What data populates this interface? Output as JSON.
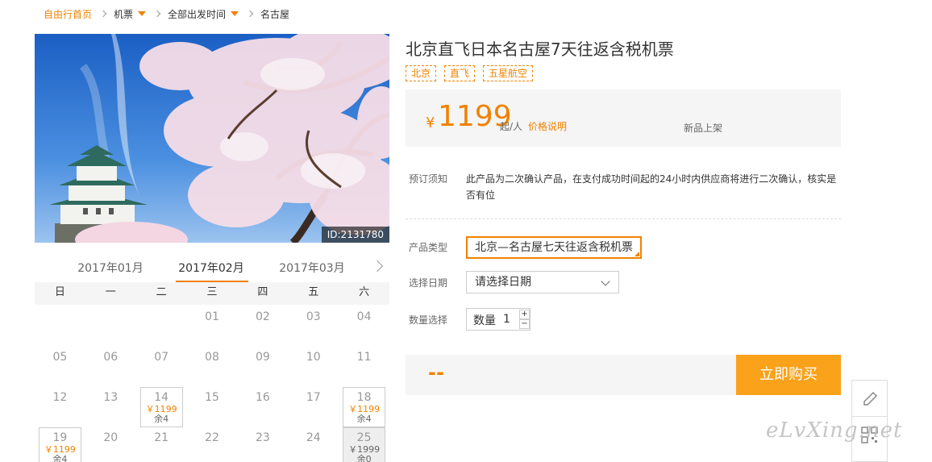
{
  "breadcrumb": {
    "home": "自由行首页",
    "flights": "机票",
    "departure": "全部出发时间",
    "current": "名古屋"
  },
  "hero": {
    "id_label": "ID:2131780"
  },
  "calendar": {
    "months": [
      "2017年01月",
      "2017年02月",
      "2017年03月"
    ],
    "weekdays": [
      "日",
      "一",
      "二",
      "三",
      "四",
      "五",
      "六"
    ],
    "rows": [
      [
        {
          "d": ""
        },
        {
          "d": ""
        },
        {
          "d": ""
        },
        {
          "d": "01"
        },
        {
          "d": "02"
        },
        {
          "d": "03"
        },
        {
          "d": "04"
        }
      ],
      [
        {
          "d": "05"
        },
        {
          "d": "06"
        },
        {
          "d": "07"
        },
        {
          "d": "08"
        },
        {
          "d": "09"
        },
        {
          "d": "10"
        },
        {
          "d": "11"
        }
      ],
      [
        {
          "d": "12"
        },
        {
          "d": "13"
        },
        {
          "d": "14",
          "p": "￥1199",
          "r": "余4"
        },
        {
          "d": "15"
        },
        {
          "d": "16"
        },
        {
          "d": "17"
        },
        {
          "d": "18",
          "p": "￥1199",
          "r": "余4"
        }
      ],
      [
        {
          "d": "19",
          "p": "￥1199",
          "r": "余4"
        },
        {
          "d": "20"
        },
        {
          "d": "21"
        },
        {
          "d": "22"
        },
        {
          "d": "23"
        },
        {
          "d": "24"
        },
        {
          "d": "25",
          "p": "￥1999",
          "r": "余0",
          "soldout": true
        }
      ]
    ]
  },
  "product": {
    "title": "北京直飞日本名古屋7天往返含税机票",
    "tags": [
      "北京",
      "直飞",
      "五星航空"
    ],
    "currency": "¥",
    "price": "1199",
    "per_person": "起/人",
    "price_note": "价格说明",
    "new_label": "新品上架"
  },
  "booking": {
    "notice_label": "预订须知",
    "notice_text": "此产品为二次确认产品，在支付成功时间起的24小时内供应商将进行二次确认，核实是否有位",
    "type_label": "产品类型",
    "type_value": "北京—名古屋七天往返含税机票",
    "date_label": "选择日期",
    "date_placeholder": "请选择日期",
    "qty_label": "数量选择",
    "qty_inner_label": "数量",
    "qty_value": "1",
    "total": "--",
    "buy_label": "立即购买"
  },
  "watermark": "eLvXing.net",
  "colors": {
    "accent": "#f08200",
    "buy_button": "#f9a21a",
    "panel": "#f5f5f5"
  }
}
